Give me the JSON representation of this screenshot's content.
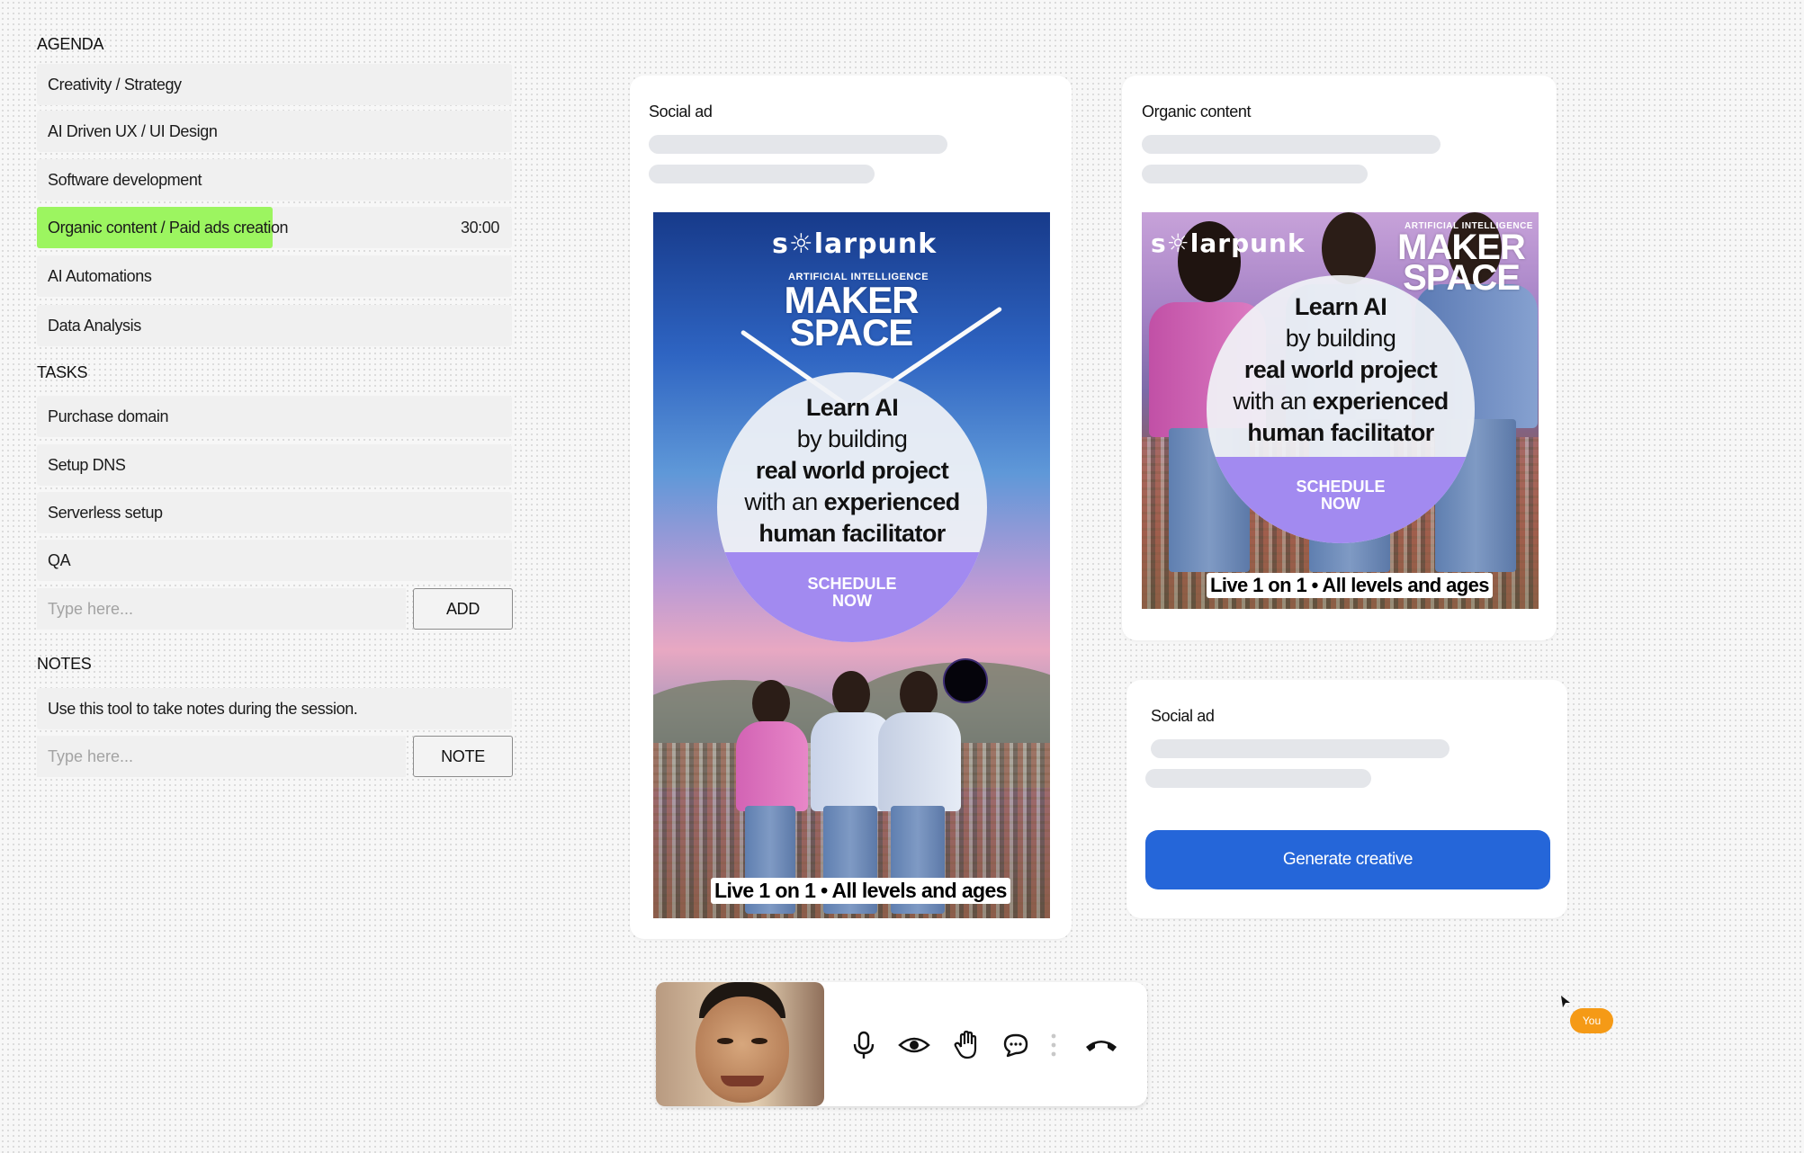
{
  "agenda": {
    "title": "AGENDA",
    "items": [
      {
        "label": "Creativity / Strategy"
      },
      {
        "label": "AI Driven UX / UI Design"
      },
      {
        "label": "Software development"
      },
      {
        "label": "Organic content / Paid ads creation",
        "timer": "30:00",
        "active": true
      },
      {
        "label": "AI Automations"
      },
      {
        "label": "Data Analysis"
      }
    ]
  },
  "tasks": {
    "title": "TASKS",
    "items": [
      {
        "label": "Purchase domain"
      },
      {
        "label": "Setup DNS"
      },
      {
        "label": "Serverless setup"
      },
      {
        "label": "QA"
      }
    ],
    "input_placeholder": "Type here...",
    "add_label": "ADD"
  },
  "notes": {
    "title": "NOTES",
    "items": [
      {
        "label": "Use this tool to take notes during the session."
      }
    ],
    "input_placeholder": "Type here...",
    "note_label": "NOTE"
  },
  "cards": {
    "social_ad_main": {
      "title": "Social ad"
    },
    "organic": {
      "title": "Organic content"
    },
    "social_ad_second": {
      "title": "Social ad",
      "generate_label": "Generate creative"
    }
  },
  "creative": {
    "logo": "s☼larpunk",
    "ai_label": "ARTIFICIAL INTELLIGENCE",
    "maker_line1": "MAKER",
    "maker_line2": "SPACE",
    "line1": "Learn AI",
    "line2": "by building",
    "line3": "real world project",
    "line4_a": "with an",
    "line4_b": "experienced",
    "line5": "human facilitator",
    "cta_1": "SCHEDULE",
    "cta_2": "NOW",
    "tagline": "Live 1 on 1  •  All levels and ages"
  },
  "presence": {
    "you_label": "You"
  },
  "colors": {
    "accent": "#2566d9",
    "highlight": "#9cf560",
    "cta": "#a28af0",
    "badge": "#f59a16"
  }
}
